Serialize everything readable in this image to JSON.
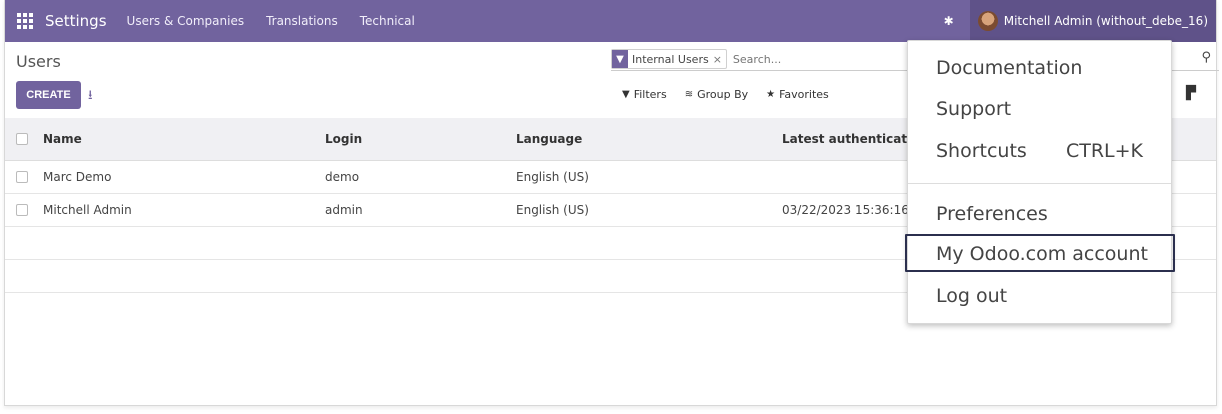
{
  "navbar": {
    "brand": "Settings",
    "items": [
      "Users & Companies",
      "Translations",
      "Technical"
    ],
    "user": "Mitchell Admin (without_debe_16)"
  },
  "control": {
    "breadcrumb": "Users",
    "create_label": "CREATE",
    "facet_label": "Internal Users",
    "facet_remove": "×",
    "search_placeholder": "Search...",
    "filters_label": "Filters",
    "groupby_label": "Group By",
    "favorites_label": "Favorites"
  },
  "table": {
    "columns": [
      "Name",
      "Login",
      "Language",
      "Latest authentication"
    ],
    "rows": [
      {
        "name": "Marc Demo",
        "login": "demo",
        "language": "English (US)",
        "auth": ""
      },
      {
        "name": "Mitchell Admin",
        "login": "admin",
        "language": "English (US)",
        "auth": "03/22/2023 15:36:16"
      }
    ]
  },
  "user_menu": {
    "documentation": "Documentation",
    "support": "Support",
    "shortcuts": "Shortcuts",
    "shortcuts_key": "CTRL+K",
    "preferences": "Preferences",
    "account": "My Odoo.com account",
    "logout": "Log out"
  },
  "colors": {
    "accent": "#71639e",
    "accent_dark": "#5f5289"
  }
}
